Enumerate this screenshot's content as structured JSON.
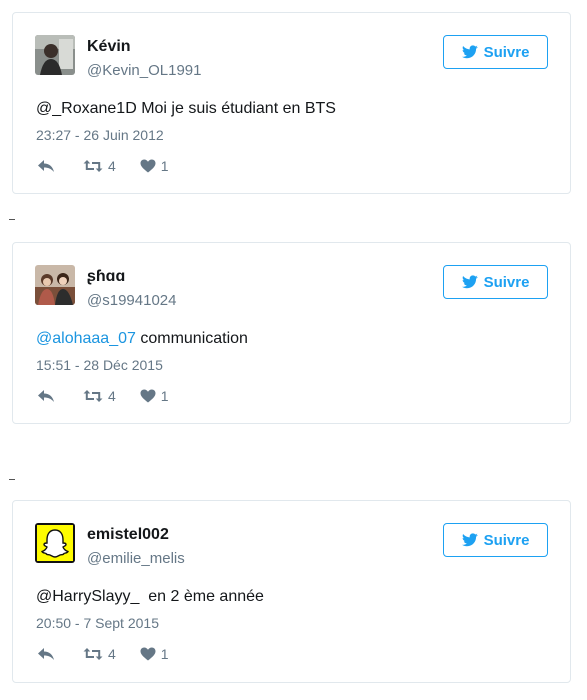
{
  "follow_label": "Suivre",
  "colors": {
    "accent": "#1da1f2",
    "muted": "#657786",
    "link": "#1b95e0"
  },
  "icons": {
    "reply": "reply-icon",
    "retweet": "retweet-icon",
    "like": "heart-icon",
    "follow": "twitter-bird-icon"
  },
  "separator_mark": "-",
  "tweets": [
    {
      "name": "Kévin",
      "handle": "@Kevin_OL1991",
      "text_mention": "",
      "text": "@_Roxane1D Moi je suis étudiant en BTS",
      "time": "23:27 - 26 Juin 2012",
      "retweets": "4",
      "likes": "1"
    },
    {
      "name": "ʂɦɑɑ",
      "handle": "@s19941024",
      "text_mention": "@alohaaa_07",
      "text": " communication",
      "time": "15:51 - 28 Déc 2015",
      "retweets": "4",
      "likes": "1"
    },
    {
      "name": "emistel002",
      "handle": "@emilie_melis",
      "text_mention": "",
      "text": "@HarrySlayy_  en 2 ème année",
      "time": "20:50 - 7 Sept 2015",
      "retweets": "4",
      "likes": "1"
    }
  ]
}
